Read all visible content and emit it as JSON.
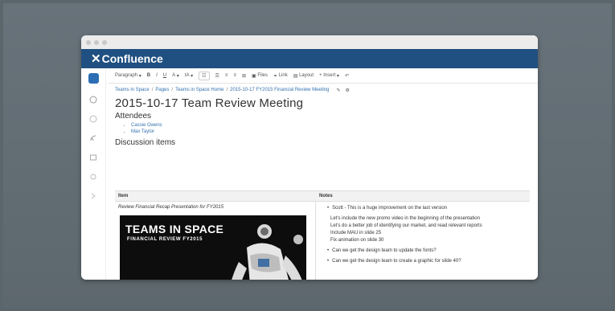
{
  "app": {
    "name": "Confluence"
  },
  "toolbar": {
    "paragraph": "Paragraph",
    "bold": "B",
    "italic": "I",
    "underline": "U",
    "font_color": "A",
    "font_size": "tA",
    "bullet_list": "☷",
    "numbered_list": "☰",
    "align_left": "≡",
    "align_center": "≡",
    "table": "⊞",
    "files": "Files",
    "link": "Link",
    "layout": "Layout",
    "insert": "Insert",
    "undo": "↶"
  },
  "breadcrumb": {
    "items": [
      "Teams in Space",
      "Pages",
      "Teams in Space Home",
      "2015-10-17 FY2015 Financial Review Meeting"
    ],
    "separator": "/"
  },
  "page": {
    "title": "2015-10-17  Team Review Meeting",
    "attendees_heading": "Attendees",
    "attendees": [
      "Cassie Owens",
      "Max Taylor"
    ],
    "discussion_heading": "Discussion items"
  },
  "table": {
    "headers": {
      "item": "Item",
      "notes": "Notes"
    },
    "row": {
      "item": "Review Financial Recap Presentation for FY2015",
      "image": {
        "title": "TEAMS IN SPACE",
        "subtitle": "FINANCIAL REVIEW  FY2015"
      },
      "notes": {
        "first": "Scott - This is a huge improvement on the last version",
        "sub": [
          "Let's include the new promo video in the beginning of the presentation",
          "Let's do a better job of identifying our market, and read relevant reports",
          "Include MAU in slide 25",
          "Fix animation on slide 30"
        ],
        "second": "Can we get the design team to update the fonts?",
        "third": "Can we get the design team to create a graphic for slide 40?"
      }
    }
  },
  "colors": {
    "header": "#205081",
    "link": "#3572b0",
    "background": "#5b666c"
  }
}
